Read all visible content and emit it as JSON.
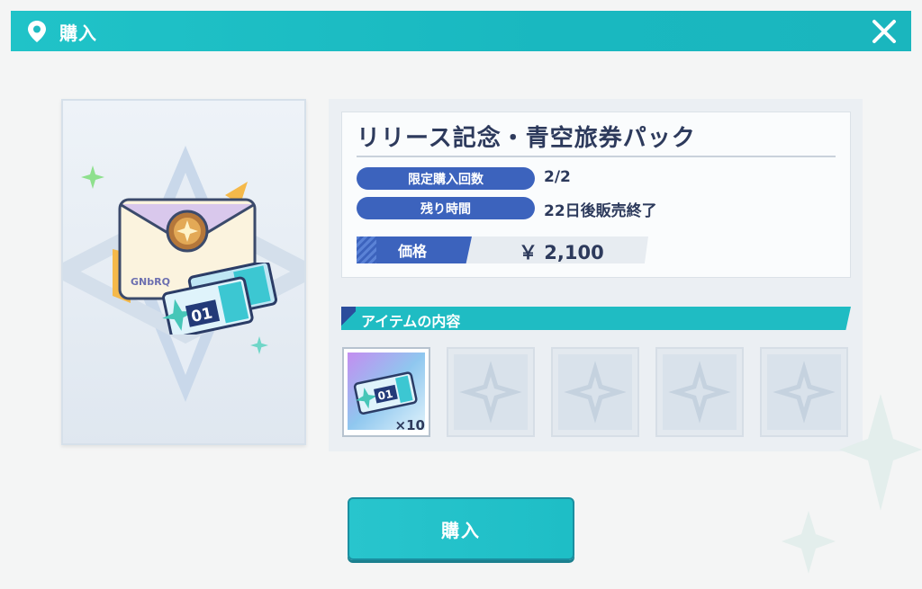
{
  "header": {
    "title": "購入"
  },
  "product": {
    "title": "リリース記念・青空旅券パック",
    "purchase_limit_label": "限定購入回数",
    "purchase_limit_value": "2/2",
    "remaining_label": "残り時間",
    "remaining_value": "22日後販売終了",
    "price_label": "価格",
    "price_value": "￥ 2,100"
  },
  "items_section": {
    "title": "アイテムの内容",
    "items": [
      {
        "icon": "ticket-icon",
        "quantity": "×10"
      },
      {
        "icon": "empty-slot-icon"
      },
      {
        "icon": "empty-slot-icon"
      },
      {
        "icon": "empty-slot-icon"
      },
      {
        "icon": "empty-slot-icon"
      }
    ]
  },
  "preview": {
    "ticket_number": "01",
    "envelope_text": "GNbRQ"
  },
  "buy_button": {
    "label": "購入"
  },
  "colors": {
    "accent": "#1fbcc3",
    "primary_blue": "#3c63bd",
    "text": "#2d3a5c"
  }
}
